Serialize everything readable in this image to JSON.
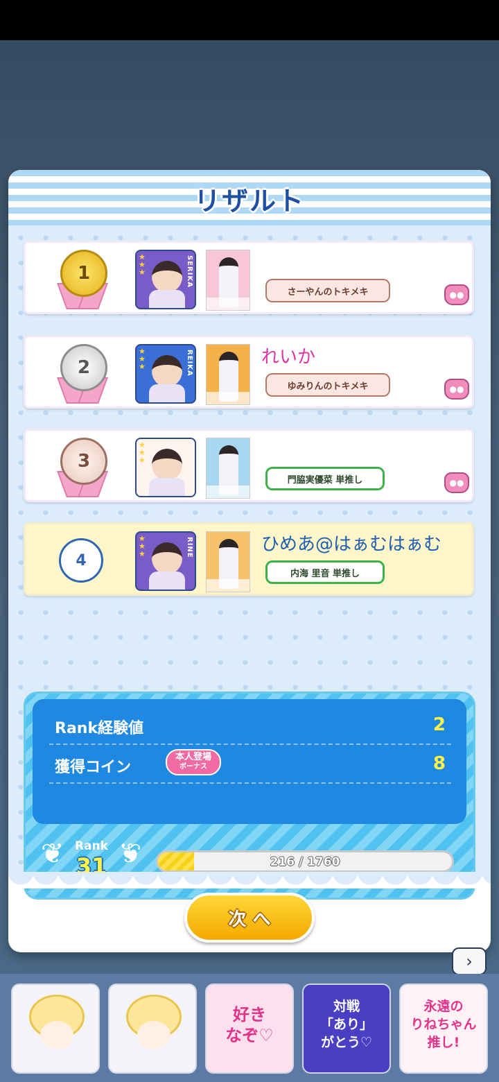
{
  "dialog": {
    "title": "リザルト"
  },
  "ranking": [
    {
      "place": "1",
      "style": "medal-gold",
      "avatar_name": "SERIKA",
      "player_name": "",
      "tag": "さーやんのトキメキ",
      "tag_style": "pink",
      "has_pig": true,
      "avatar_bg": "#7a5cc9",
      "card_bg": "#f7c7d9"
    },
    {
      "place": "2",
      "style": "medal-silver",
      "avatar_name": "REIKA",
      "player_name": "れいか",
      "name_color": "#e033a6",
      "tag": "ゆみりんのトキメキ",
      "tag_style": "pink",
      "has_pig": true,
      "avatar_bg": "#3a6fd8",
      "card_bg": "#f5b24a"
    },
    {
      "place": "3",
      "style": "medal-bronze",
      "avatar_name": "",
      "player_name": "",
      "tag": "門脇実優菜 単推し",
      "tag_style": "green",
      "has_pig": true,
      "avatar_bg": "#fff4f0",
      "card_bg": "#a7d8ef"
    },
    {
      "place": "4",
      "style": "circle",
      "avatar_name": "RINE",
      "player_name": "ひめあ@はぁむはぁむ",
      "name_color": "#1d5fb0",
      "tag": "内海 里音 単推し",
      "tag_style": "green",
      "has_pig": false,
      "avatar_bg": "#7a5cc9",
      "card_bg": "#f7c36a",
      "is_me": true
    }
  ],
  "results": {
    "rank_exp_label": "Rank経験値",
    "rank_exp_value": "2",
    "coin_label": "獲得コイン",
    "coin_value": "8",
    "bonus_line1": "本人登場",
    "bonus_line2": "ボーナス"
  },
  "rank": {
    "label": "Rank",
    "value": "31",
    "exp_text": "216 / 1760",
    "exp_current": 216,
    "exp_max": 1760
  },
  "next_button": "次 へ",
  "chevron_icon": "chevron-right-icon",
  "stamps": [
    {
      "type": "character",
      "name": "cheer-stamp-icon",
      "text": ""
    },
    {
      "type": "character",
      "name": "cry-stamp-icon",
      "text": ""
    },
    {
      "type": "text",
      "name": "suki-nazo-stamp",
      "text": "好き\nなぞ♡",
      "color": "#e2338b",
      "bg": "#fde0ee"
    },
    {
      "type": "text",
      "name": "taisen-arigatou-stamp",
      "text": "対戦\n「あり」\nがとう♡",
      "color": "#ffffff",
      "bg": "#4a3fc2"
    },
    {
      "type": "text",
      "name": "eien-oshi-stamp",
      "text": "永遠の\nりねちゃん\n推し!",
      "color": "#e2338b",
      "bg": "#fff2f7"
    }
  ]
}
